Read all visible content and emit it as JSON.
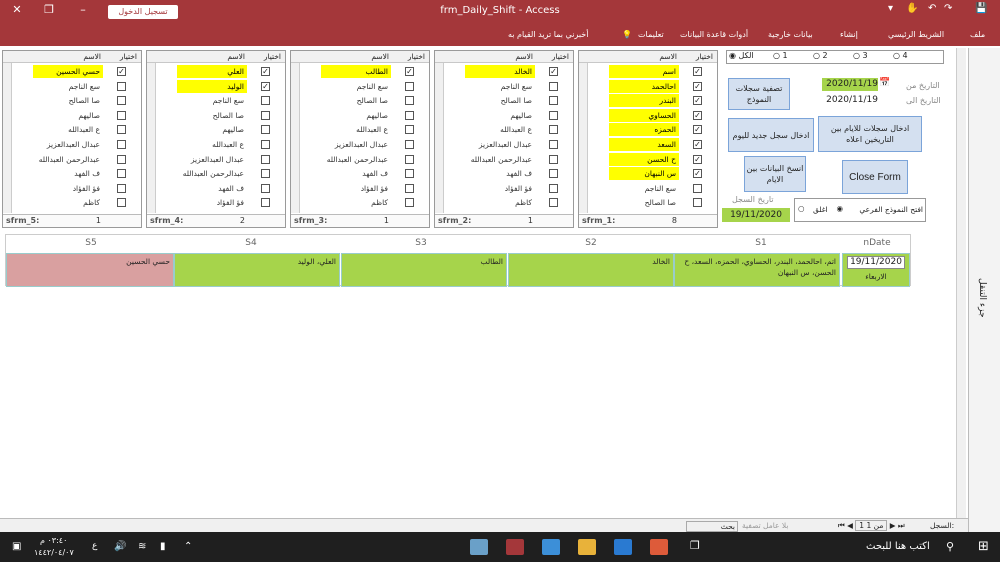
{
  "window": {
    "title": "frm_Daily_Shift  -  Access",
    "signin": "تسجيل الدخول"
  },
  "ribbon": {
    "tabs": [
      "ملف",
      "الشريط الرئيسي",
      "إنشاء",
      "بيانات خارجية",
      "أدوات قاعدة البيانات",
      "تعليمات"
    ],
    "tell": "أخبرني بما تريد القيام به"
  },
  "headers": {
    "name": "الاسم",
    "choose": "اختيار"
  },
  "subforms": [
    {
      "label": "sfrm_1:",
      "count": "8",
      "rows": [
        {
          "n": "اسم",
          "c": true
        },
        {
          "n": "احالحمد",
          "c": true
        },
        {
          "n": "البندر",
          "c": true
        },
        {
          "n": "الحساوي",
          "c": true
        },
        {
          "n": "الحمزه",
          "c": true
        },
        {
          "n": "السعد",
          "c": true
        },
        {
          "n": "ح الحسن",
          "c": true
        },
        {
          "n": "س النبهان",
          "c": true
        },
        {
          "n": "سع الناجم",
          "c": false
        },
        {
          "n": "صا الصالح",
          "c": false
        }
      ]
    },
    {
      "label": "sfrm_2:",
      "count": "1",
      "rows": [
        {
          "n": "الخالد",
          "c": true
        },
        {
          "n": "سع الناجم",
          "c": false
        },
        {
          "n": "صا الصالح",
          "c": false
        },
        {
          "n": "صاليهم",
          "c": false
        },
        {
          "n": "ع العبدالله",
          "c": false
        },
        {
          "n": "عبدال العبدالعزيز",
          "c": false
        },
        {
          "n": "عبدالرحمن العبدالله",
          "c": false
        },
        {
          "n": "ف الفهد",
          "c": false
        },
        {
          "n": "فؤ الفؤاد",
          "c": false
        },
        {
          "n": "كاظم",
          "c": false
        }
      ]
    },
    {
      "label": "sfrm_3:",
      "count": "1",
      "rows": [
        {
          "n": "الطالب",
          "c": true
        },
        {
          "n": "سع الناجم",
          "c": false
        },
        {
          "n": "صا الصالح",
          "c": false
        },
        {
          "n": "صاليهم",
          "c": false
        },
        {
          "n": "ع العبدالله",
          "c": false
        },
        {
          "n": "عبدال العبدالعزيز",
          "c": false
        },
        {
          "n": "عبدالرحمن العبدالله",
          "c": false
        },
        {
          "n": "ف الفهد",
          "c": false
        },
        {
          "n": "فؤ الفؤاد",
          "c": false
        },
        {
          "n": "كاظم",
          "c": false
        }
      ]
    },
    {
      "label": "sfrm_4:",
      "count": "2",
      "rows": [
        {
          "n": "العلي",
          "c": true
        },
        {
          "n": "الوليد",
          "c": true
        },
        {
          "n": "سع الناجم",
          "c": false
        },
        {
          "n": "صا الصالح",
          "c": false
        },
        {
          "n": "صاليهم",
          "c": false
        },
        {
          "n": "ع العبدالله",
          "c": false
        },
        {
          "n": "عبدال العبدالعزيز",
          "c": false
        },
        {
          "n": "عبدالرحمن العبدالله",
          "c": false
        },
        {
          "n": "ف الفهد",
          "c": false
        },
        {
          "n": "فؤ الفؤاد",
          "c": false
        }
      ]
    },
    {
      "label": "sfrm_5:",
      "count": "1",
      "rows": [
        {
          "n": "حسي الحسين",
          "c": true
        },
        {
          "n": "سع الناجم",
          "c": false
        },
        {
          "n": "صا الصالح",
          "c": false
        },
        {
          "n": "صاليهم",
          "c": false
        },
        {
          "n": "ع العبدالله",
          "c": false
        },
        {
          "n": "عبدال العبدالعزيز",
          "c": false
        },
        {
          "n": "عبدالرحمن العبدالله",
          "c": false
        },
        {
          "n": "ف الفهد",
          "c": false
        },
        {
          "n": "فؤ الفؤاد",
          "c": false
        },
        {
          "n": "كاظم",
          "c": false
        }
      ]
    }
  ],
  "controls": {
    "radios": [
      "الكل",
      "1",
      "2",
      "3",
      "4"
    ],
    "date_from_label": "التاريخ من",
    "date_to_label": "التاريخ الى",
    "date_from": "2020/11/19",
    "date_to": "2020/11/19",
    "filter_btn": "تصفية سجلات النموذج",
    "insert_range_btn": "ادخال سجلات للايام بين التاريخين اعلاه",
    "insert_today_btn": "ادخال سجل جديد لليوم",
    "copy_btn": "انسخ البيانات بين الايام",
    "close_btn": "Close Form",
    "record_date_label": "تاريخ السجل",
    "record_date": "19/11/2020",
    "open_form_label": "افتح النموذج الفرعي",
    "close_label": "اغلق"
  },
  "grid": {
    "headers": [
      "nDate",
      "S1",
      "S2",
      "S3",
      "S4",
      "S5"
    ],
    "row": {
      "date": "19/11/2020",
      "day": "الاربعاء",
      "s1": "اتم، احالحمد، البندر، الحساوي، الحمزه، السعد، ح الحسن، س النبهان",
      "s2": "الخالد",
      "s3": "الطالب",
      "s4": "العلي، الوليد",
      "s5": "حسي الحسين"
    }
  },
  "nav_pane": "جزء التنقل",
  "status": {
    "record": "السجل:",
    "pos": "1 من 1",
    "filter": "بلا عامل تصفية",
    "search": "بحث"
  },
  "taskbar": {
    "search": "اكتب هنا للبحث",
    "time": "٠٣:٤٠ م",
    "date": "١٤٤٢/٠٤/٠٧",
    "lang": "ع"
  },
  "colors": {
    "title": "#a4373a",
    "selected": "#ffff00",
    "green": "#a6d44b",
    "pink": "#d9a0a0"
  }
}
